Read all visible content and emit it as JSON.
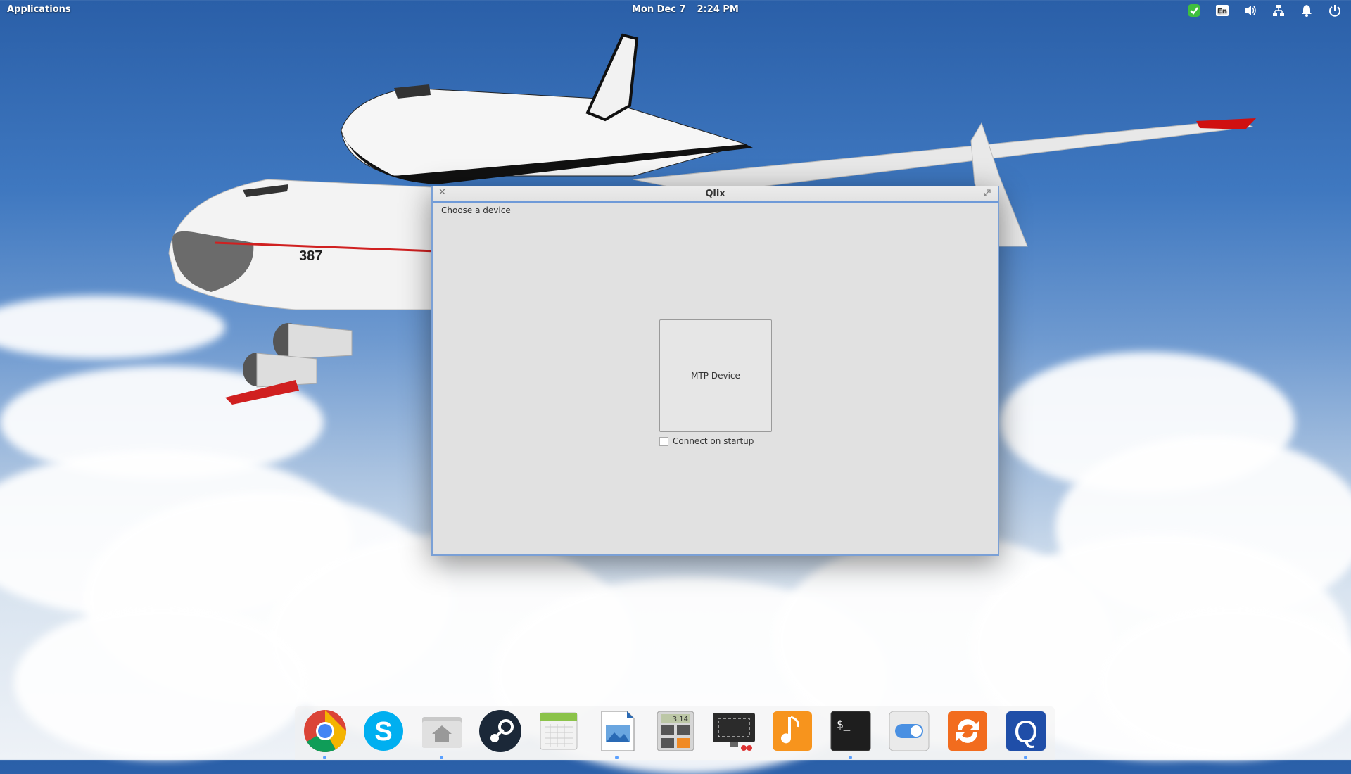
{
  "topbar": {
    "applications_label": "Applications",
    "date": "Mon Dec 7",
    "time": "2:24 PM",
    "tray_icons": [
      "checkmark-shield-icon",
      "keyboard-layout-en-icon",
      "volume-icon",
      "network-icon",
      "notification-bell-icon",
      "power-icon"
    ],
    "keyboard_layout": "En"
  },
  "window": {
    "title": "Qlix",
    "group_label": "Choose a device",
    "device_button_label": "MTP Device",
    "connect_on_startup_label": "Connect on startup",
    "connect_on_startup_checked": false
  },
  "dock": {
    "items": [
      {
        "name": "chrome-icon",
        "running": true
      },
      {
        "name": "skype-icon",
        "running": false
      },
      {
        "name": "files-home-icon",
        "running": true
      },
      {
        "name": "steam-icon",
        "running": false
      },
      {
        "name": "calendar-icon",
        "running": false
      },
      {
        "name": "image-viewer-icon",
        "running": true
      },
      {
        "name": "calculator-icon",
        "calc_display": "3.14",
        "running": false
      },
      {
        "name": "screenshot-icon",
        "running": false
      },
      {
        "name": "music-icon",
        "running": false
      },
      {
        "name": "terminal-icon",
        "terminal_prompt": "$_",
        "running": true
      },
      {
        "name": "settings-toggle-icon",
        "running": false
      },
      {
        "name": "software-update-icon",
        "running": false
      },
      {
        "name": "qlix-icon",
        "running": true
      }
    ]
  },
  "wallpaper": {
    "aircraft_tail_number": "387"
  }
}
